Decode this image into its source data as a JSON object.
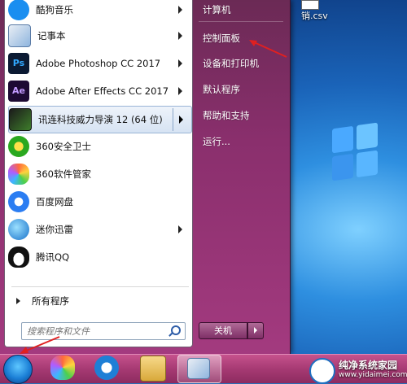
{
  "desktop": {
    "file_label": "销.csv"
  },
  "start_menu": {
    "programs": [
      {
        "label": "酷狗音乐",
        "icon": "kugou-music-icon",
        "submenu": true
      },
      {
        "label": "记事本",
        "icon": "notepad-icon",
        "submenu": true
      },
      {
        "label": "Adobe Photoshop CC 2017",
        "icon": "photoshop-icon",
        "submenu": true
      },
      {
        "label": "Adobe After Effects CC 2017",
        "icon": "after-effects-icon",
        "submenu": true
      },
      {
        "label": "讯连科技威力导演 12 (64 位)",
        "icon": "powerdirector-icon",
        "submenu": true
      },
      {
        "label": "360安全卫士",
        "icon": "360-security-icon",
        "submenu": false
      },
      {
        "label": "360软件管家",
        "icon": "360-software-icon",
        "submenu": false
      },
      {
        "label": "百度网盘",
        "icon": "baidu-netdisk-icon",
        "submenu": false
      },
      {
        "label": "迷你迅雷",
        "icon": "xunlei-icon",
        "submenu": true
      },
      {
        "label": "腾讯QQ",
        "icon": "qq-icon",
        "submenu": false
      }
    ],
    "all_programs": "所有程序",
    "search_placeholder": "搜索程序和文件",
    "right_items": [
      "计算机",
      "控制面板",
      "设备和打印机",
      "默认程序",
      "帮助和支持",
      "运行..."
    ],
    "shutdown_label": "关机"
  },
  "watermark": {
    "title": "纯净系统家园",
    "url": "www.yidaimei.com"
  },
  "colors": {
    "menu_bg": "#8a2f6d",
    "taskbar": "#a63a73",
    "highlight": "#d6e3f3",
    "arrow": "#e02020"
  }
}
